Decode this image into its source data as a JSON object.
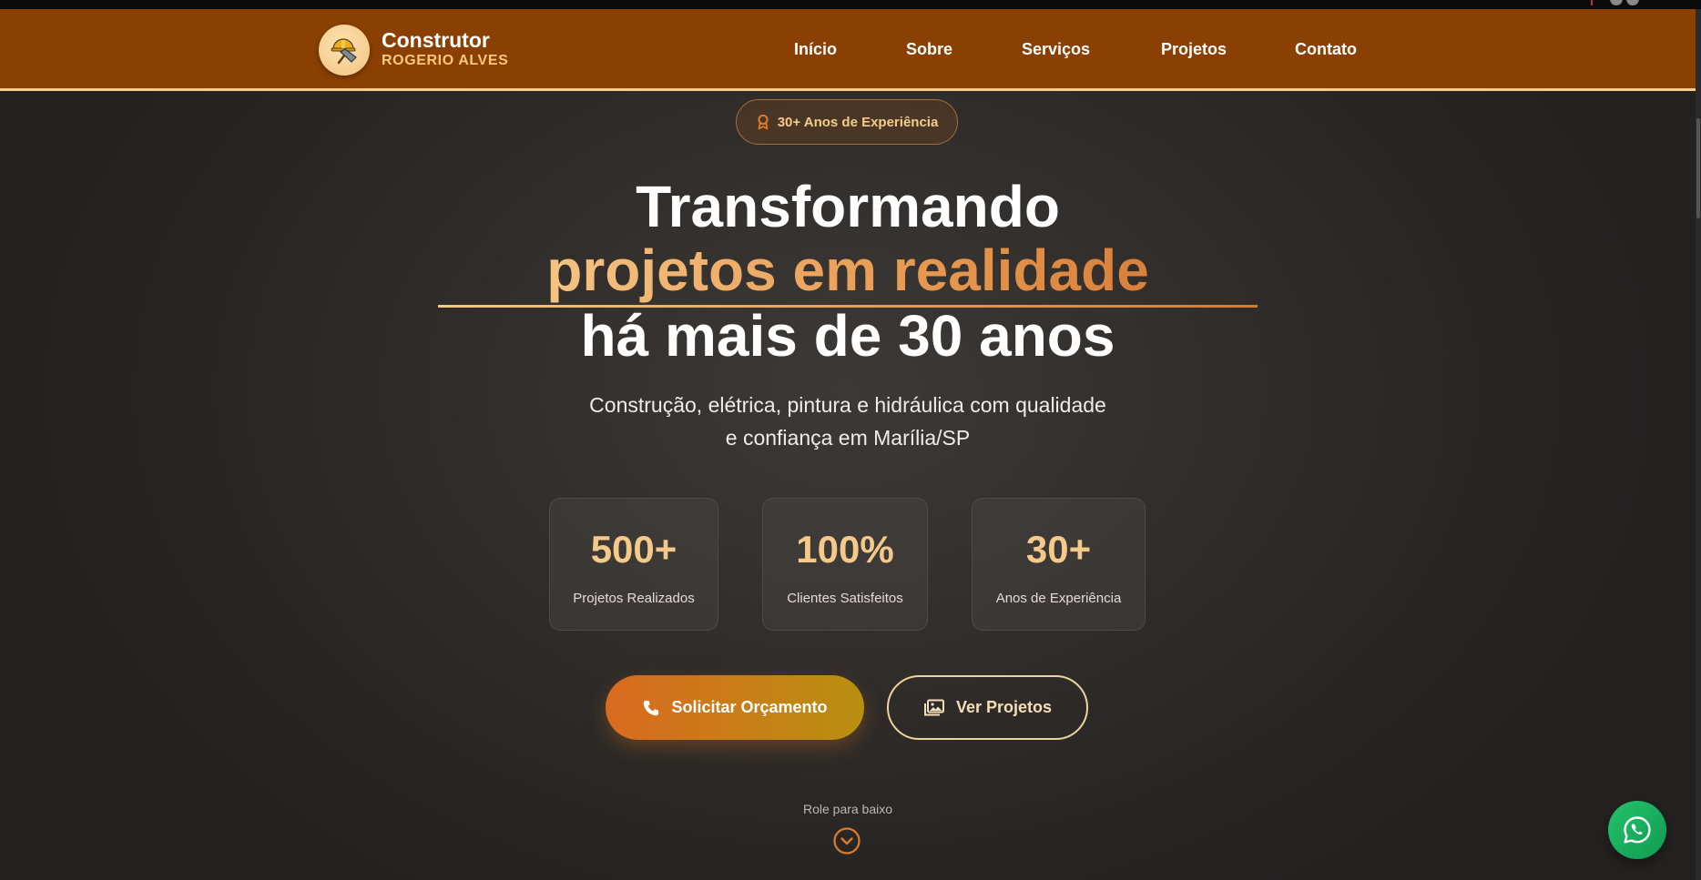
{
  "brand": {
    "title": "Construtor",
    "subtitle": "ROGERIO ALVES"
  },
  "nav": [
    "Início",
    "Sobre",
    "Serviços",
    "Projetos",
    "Contato"
  ],
  "hero": {
    "badge": "30+ Anos de Experiência",
    "title_line1": "Transformando",
    "title_line2": "projetos em realidade",
    "title_line3": "há mais de 30 anos",
    "subtitle_line1": "Construção, elétrica, pintura e hidráulica com qualidade",
    "subtitle_line2": "e confiança em Marília/SP"
  },
  "stats": [
    {
      "value": "500+",
      "label": "Projetos Realizados"
    },
    {
      "value": "100%",
      "label": "Clientes Satisfeitos"
    },
    {
      "value": "30+",
      "label": "Anos de Experiência"
    }
  ],
  "buttons": {
    "primary": "Solicitar Orçamento",
    "secondary": "Ver Projetos"
  },
  "scroll_hint": "Role para baixo",
  "icons": {
    "logo": "builder-helmet-trowel-icon",
    "badge": "award-icon",
    "primary": "phone-icon",
    "secondary": "images-icon",
    "scroll": "chevron-down-circle-icon",
    "floating": "whatsapp-icon"
  },
  "colors": {
    "header_bg": "#8a4003",
    "accent_gold": "#f5c98a",
    "accent_orange": "#d96a1e",
    "hero_bg": "#2f2c2a",
    "whatsapp": "#1fb763"
  }
}
